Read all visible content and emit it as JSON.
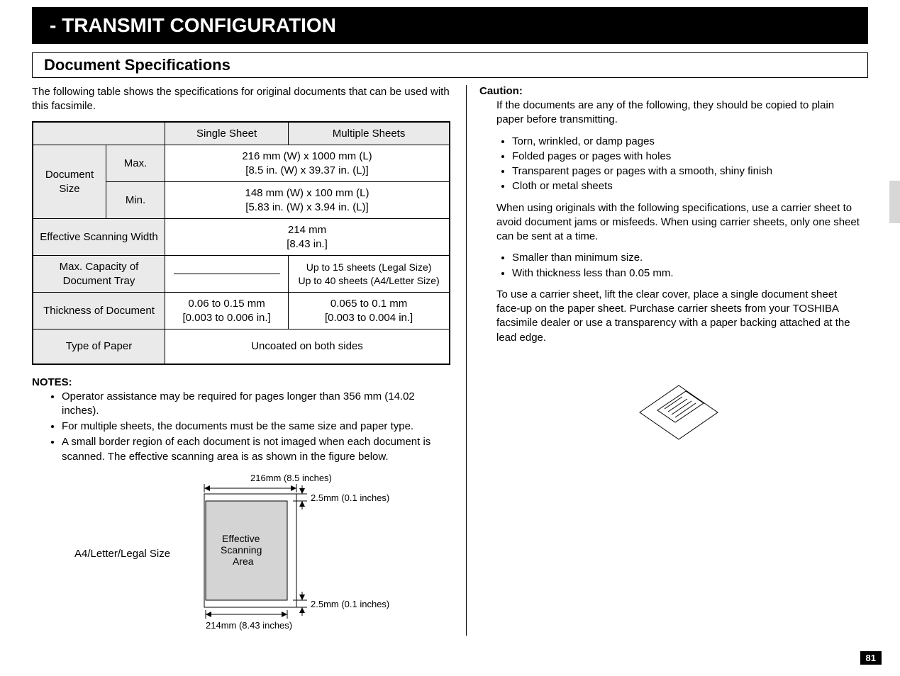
{
  "banner_title": "- TRANSMIT CONFIGURATION",
  "section_heading": "Document Specifications",
  "intro": "The following table shows the specifications for original documents that can be used with this facsimile.",
  "table": {
    "col_single": "Single Sheet",
    "col_multiple": "Multiple Sheets",
    "doc_size_label": "Document Size",
    "max_label": "Max.",
    "min_label": "Min.",
    "max_line1": "216 mm (W) x 1000 mm (L)",
    "max_line2": "[8.5 in. (W) x 39.37 in. (L)]",
    "min_line1": "148 mm (W) x 100 mm (L)",
    "min_line2": "[5.83 in. (W) x 3.94 in. (L)]",
    "eff_scan_label": "Effective Scanning Width",
    "eff_scan_line1": "214 mm",
    "eff_scan_line2": "[8.43 in.]",
    "capacity_label": "Max. Capacity of Document Tray",
    "capacity_multi_line1": "Up to 15 sheets (Legal Size)",
    "capacity_multi_line2": "Up to 40 sheets (A4/Letter Size)",
    "thickness_label": "Thickness of Document",
    "thickness_single_line1": "0.06 to 0.15 mm",
    "thickness_single_line2": "[0.003 to 0.006 in.]",
    "thickness_multi_line1": "0.065 to 0.1 mm",
    "thickness_multi_line2": "[0.003 to 0.004 in.]",
    "paper_type_label": "Type of Paper",
    "paper_type_value": "Uncoated on both sides"
  },
  "notes_heading": "NOTES:",
  "notes": [
    "Operator assistance may be required for pages longer than 356 mm (14.02 inches).",
    "For multiple sheets, the documents must be the same size and paper type.",
    "A small border region of each document is not imaged when each document is scanned. The effective scanning area is as shown in the figure below."
  ],
  "figure": {
    "side_label": "A4/Letter/Legal Size",
    "top_dim": "216mm (8.5 inches)",
    "bottom_dim": "214mm (8.43 inches)",
    "margin_top": "2.5mm (0.1 inches)",
    "margin_bottom": "2.5mm (0.1 inches)",
    "area_label_l1": "Effective",
    "area_label_l2": "Scanning",
    "area_label_l3": "Area"
  },
  "caution_heading": "Caution:",
  "caution": {
    "p1": "If the documents are any of the following, they should be copied to plain paper before transmitting.",
    "list1": [
      "Torn, wrinkled, or damp pages",
      "Folded pages or pages with holes",
      "Transparent pages or pages with a smooth, shiny finish",
      "Cloth or metal sheets"
    ],
    "p2": "When using originals with the following specifications, use a carrier sheet to avoid document jams or misfeeds. When using carrier sheets, only one sheet can be sent at a time.",
    "list2": [
      "Smaller than minimum size.",
      "With thickness less than 0.05 mm."
    ],
    "p3": "To use a carrier sheet, lift the clear cover, place a single document sheet face-up on the paper sheet. Purchase carrier sheets from your TOSHIBA facsimile dealer or use a transparency with a paper backing attached at the lead edge."
  },
  "page_number": "81"
}
